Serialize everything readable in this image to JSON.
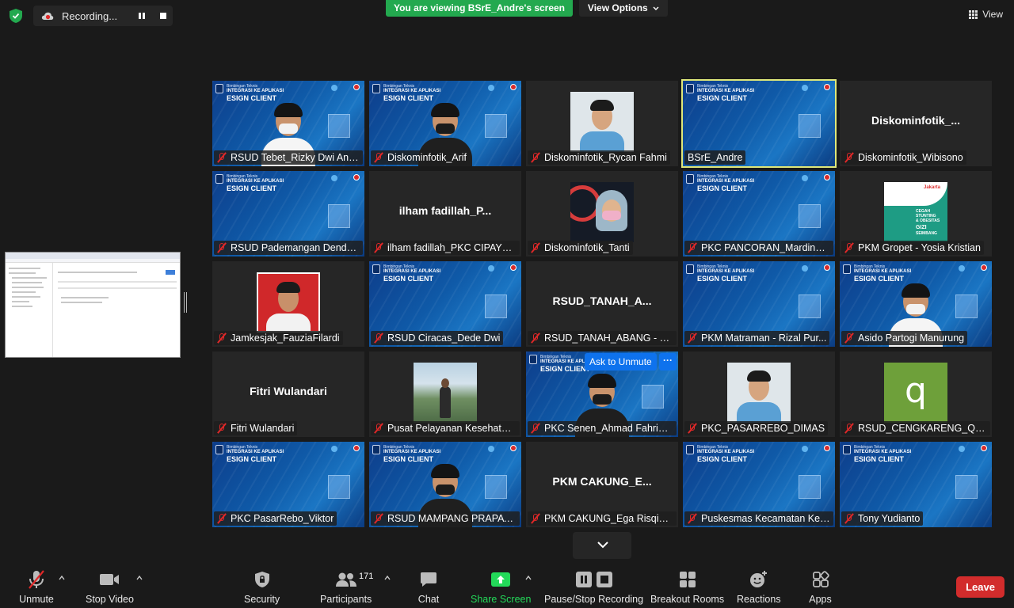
{
  "top": {
    "recording_label": "Recording...",
    "viewing_banner": "You are viewing BSrE_Andre's screen",
    "view_options": "View Options",
    "view_label": "View"
  },
  "tiles": [
    {
      "name": "RSUD Tebet_Rizky Dwi Ana...",
      "type": "slide-person"
    },
    {
      "name": "Diskominfotik_Arif",
      "type": "slide-person-dark"
    },
    {
      "name": "Diskominfotik_Rycan Fahmi",
      "type": "photo-blue"
    },
    {
      "name": "BSrE_Andre",
      "type": "slide",
      "active": true
    },
    {
      "name": "Diskominfotik_Wibisono",
      "center": "Diskominfotik_...",
      "type": "name"
    },
    {
      "name": "RSUD Pademangan Dendy ...",
      "type": "slide"
    },
    {
      "name": "ilham fadillah_PKC CIPAYUNG",
      "center": "ilham  fadillah_P...",
      "type": "name"
    },
    {
      "name": "Diskominfotik_Tanti",
      "type": "photo-hijab"
    },
    {
      "name": "PKC PANCORAN_Mardino I...",
      "type": "slide"
    },
    {
      "name": "PKM Gropet - Yosia Kristian",
      "type": "photo-cegah"
    },
    {
      "name": "Jamkesjak_FauziaFilardi",
      "type": "photo-red"
    },
    {
      "name": "RSUD Ciracas_Dede Dwi",
      "type": "slide"
    },
    {
      "name": "RSUD_TANAH_ABANG - Mu...",
      "center": "RSUD_TANAH_A...",
      "type": "name"
    },
    {
      "name": "PKM Matraman - Rizal Pur...",
      "type": "slide"
    },
    {
      "name": "Asido Partogi Manurung",
      "type": "slide-person"
    },
    {
      "name": "Fitri Wulandari",
      "center": "Fitri Wulandari",
      "type": "name"
    },
    {
      "name": "Pusat Pelayanan Kesehatan...",
      "type": "photo-mountain"
    },
    {
      "name": "PKC Senen_Ahmad Fahrian...",
      "type": "slide-person-hover"
    },
    {
      "name": "PKC_PASARREBO_DIMAS",
      "type": "photo-blue"
    },
    {
      "name": "RSUD_CENGKARENG_QAH...",
      "type": "photo-q"
    },
    {
      "name": "PKC PasarRebo_Viktor",
      "type": "slide"
    },
    {
      "name": "RSUD MAMPANG PRAPATA...",
      "type": "slide-person-dark"
    },
    {
      "name": "PKM CAKUNG_Ega Risqiap...",
      "center": "PKM  CAKUNG_E...",
      "type": "name"
    },
    {
      "name": "Puskesmas Kecamatan Keb...",
      "type": "slide"
    },
    {
      "name": "Tony Yudianto",
      "type": "slide"
    }
  ],
  "slide": {
    "line1": "Bimbingan Teknis",
    "line2": "INTEGRASI KE APLIKASI",
    "line3": "ESIGN CLIENT"
  },
  "cegah": {
    "jakarta": "Jakarta",
    "line1": "CEGAH",
    "line2": "STUNTING",
    "line3": "& OBESITAS",
    "line4": "GIZI",
    "line5": "SEIMBANG"
  },
  "q_letter": "q",
  "hover": {
    "ask_unmute": "Ask to Unmute",
    "more": "···"
  },
  "toolbar": {
    "unmute": "Unmute",
    "stop_video": "Stop Video",
    "security": "Security",
    "participants": "Participants",
    "participants_count": "171",
    "chat": "Chat",
    "share_screen": "Share Screen",
    "pause_stop_recording": "Pause/Stop Recording",
    "breakout_rooms": "Breakout Rooms",
    "reactions": "Reactions",
    "apps": "Apps",
    "leave": "Leave"
  },
  "colors": {
    "background": "#1a1a1a",
    "viewing_banner": "#23a94f",
    "active_speaker": "#dfe77a",
    "share_green": "#23d959",
    "leave_red": "#d22c2c",
    "ask_blue": "#0e72ed"
  }
}
